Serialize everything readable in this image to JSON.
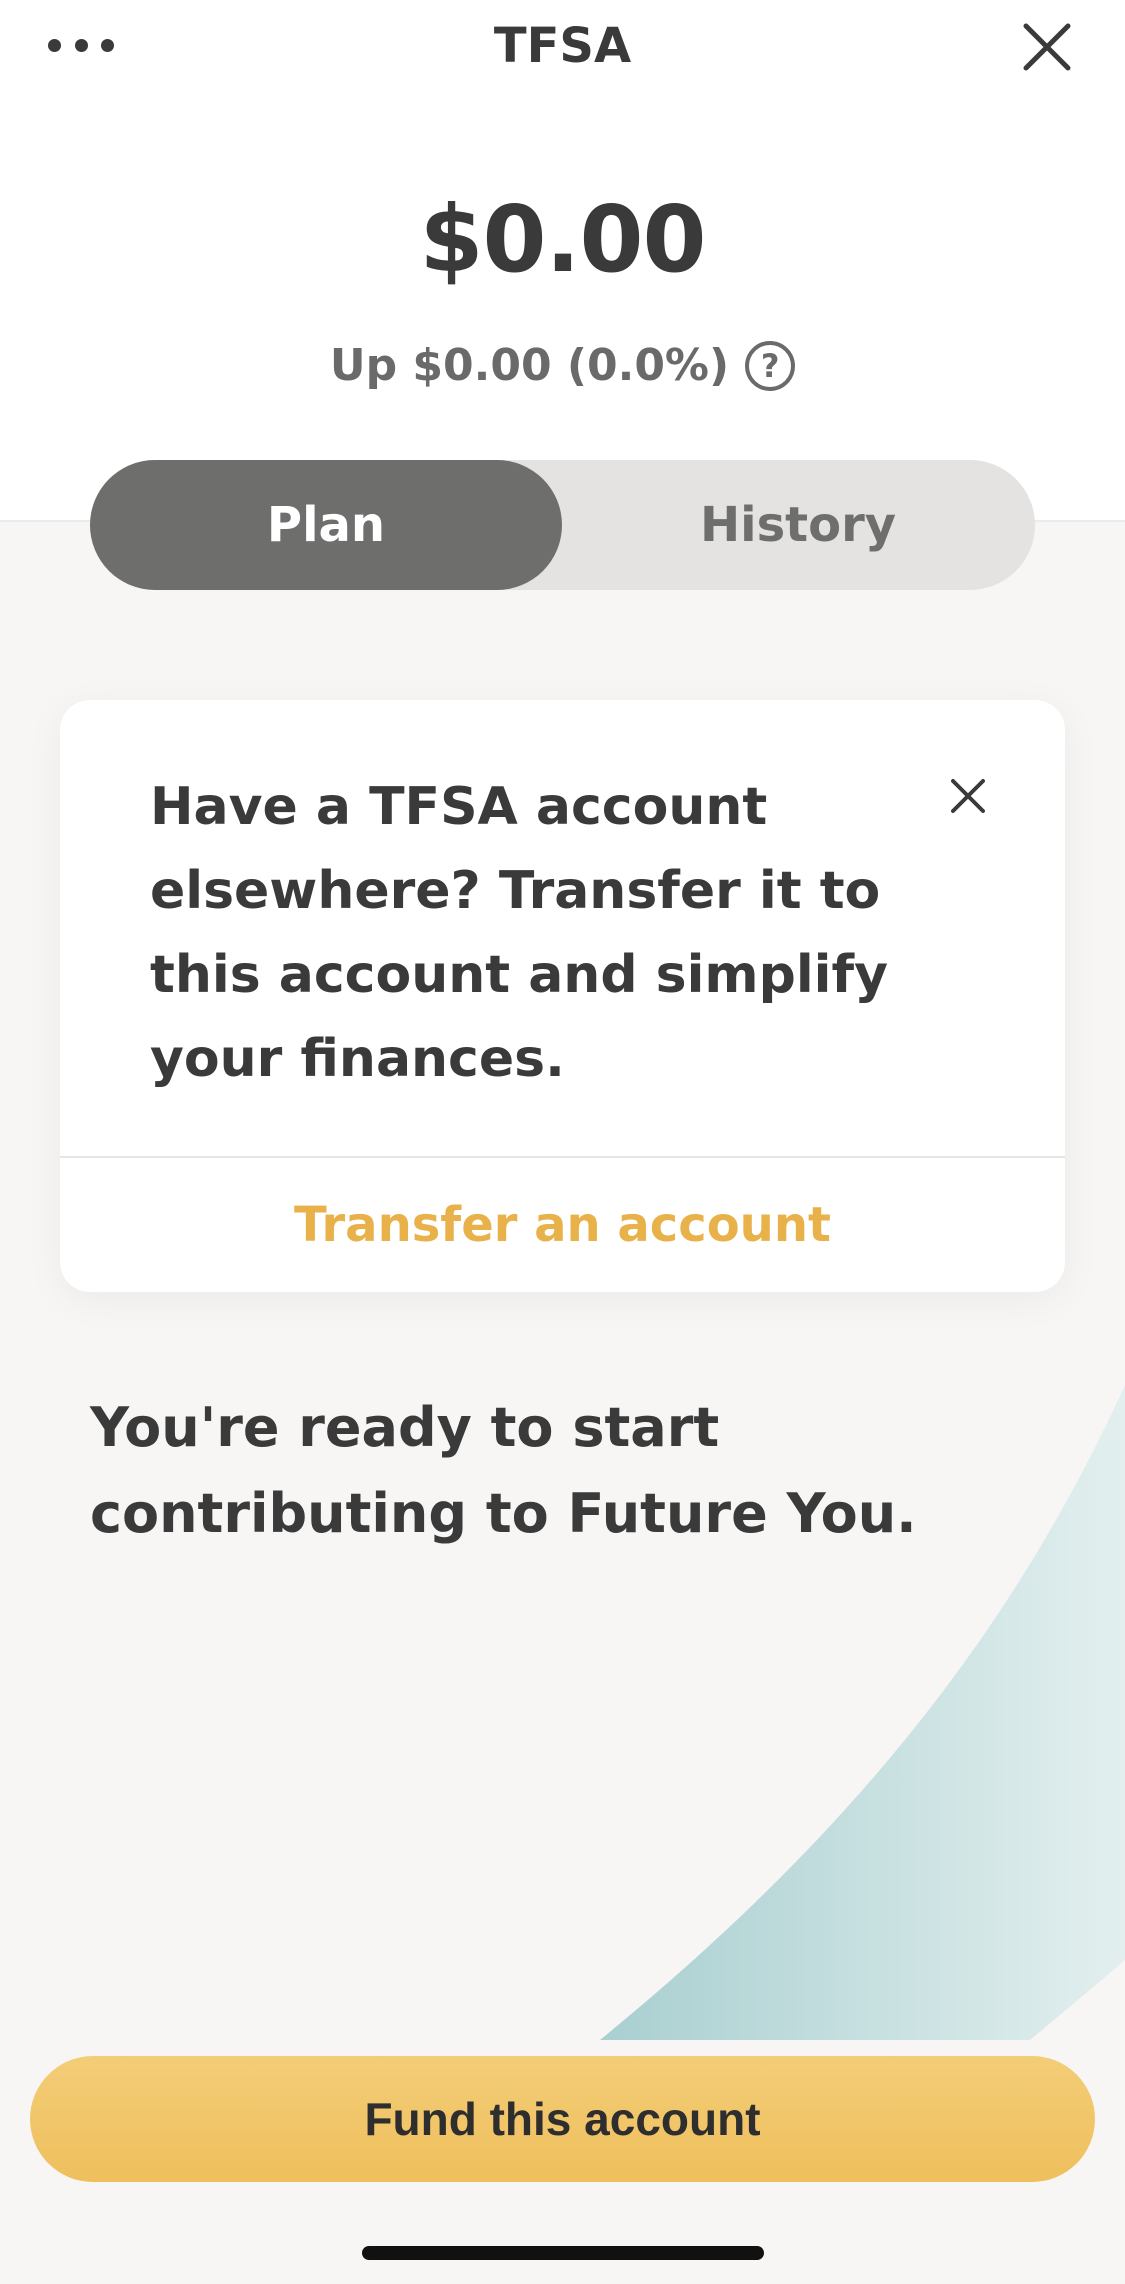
{
  "header": {
    "title": "TFSA",
    "menu_icon": "more-dots-icon",
    "close_icon": "close-icon"
  },
  "summary": {
    "balance": "$0.00",
    "change": "Up $0.00 (0.0%)",
    "help_icon": "help-circle-icon",
    "help_glyph": "?"
  },
  "tabs": {
    "items": [
      {
        "label": "Plan",
        "active": true
      },
      {
        "label": "History",
        "active": false
      }
    ]
  },
  "promo_card": {
    "message": "Have a TFSA account elsewhere? Transfer it to this account and simplify your finances.",
    "dismiss_icon": "close-icon",
    "action_label": "Transfer an account"
  },
  "main": {
    "message": "You're ready to start contributing to Future You."
  },
  "footer": {
    "primary_action": "Fund this account"
  },
  "colors": {
    "accent": "#e8b14a",
    "button": "#f1c66a",
    "tab_active": "#6e6e6d",
    "tab_track": "#e4e3e1",
    "background": "#f7f6f5",
    "decoration": "#a9cfd0"
  }
}
